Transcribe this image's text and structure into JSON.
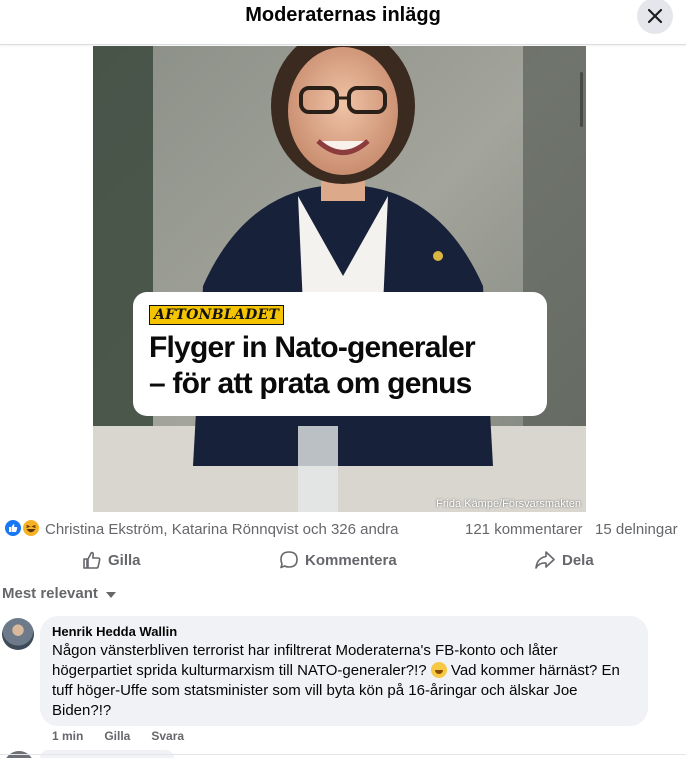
{
  "header": {
    "title": "Moderaternas inlägg",
    "close_icon": "close-icon"
  },
  "post_image": {
    "brand_logo": "AFTONBLADET",
    "headline_line1": "Flyger in Nato-generaler",
    "headline_line2": "– för att prata om genus",
    "photo_credit": "Frida Kämpe/Försvarsmakten"
  },
  "reactions": {
    "icons": [
      "like-icon",
      "haha-icon"
    ],
    "names": "Christina Ekström, Katarina Rönnqvist och 326 andra",
    "comments": "121 kommentarer",
    "shares": "15 delningar"
  },
  "actions": {
    "like": "Gilla",
    "comment": "Kommentera",
    "share": "Dela"
  },
  "sort": {
    "label": "Mest relevant"
  },
  "comment": {
    "author": "Henrik Hedda Wallin",
    "text_part1": "Någon vänsterbliven terrorist har infiltrerat Moderaterna's FB-konto och låter högerpartiet sprida kulturmarxism till NATO-generaler?!? ",
    "text_part2": " Vad kommer härnäst? En tuff höger-Uffe som statsminister som vill byta kön på 16-åringar och älskar Joe Biden?!?",
    "time": "1 min",
    "like": "Gilla",
    "reply": "Svara"
  },
  "colors": {
    "accent": "#1877f2",
    "muted_text": "#65676b",
    "bubble_bg": "#f0f2f5"
  }
}
